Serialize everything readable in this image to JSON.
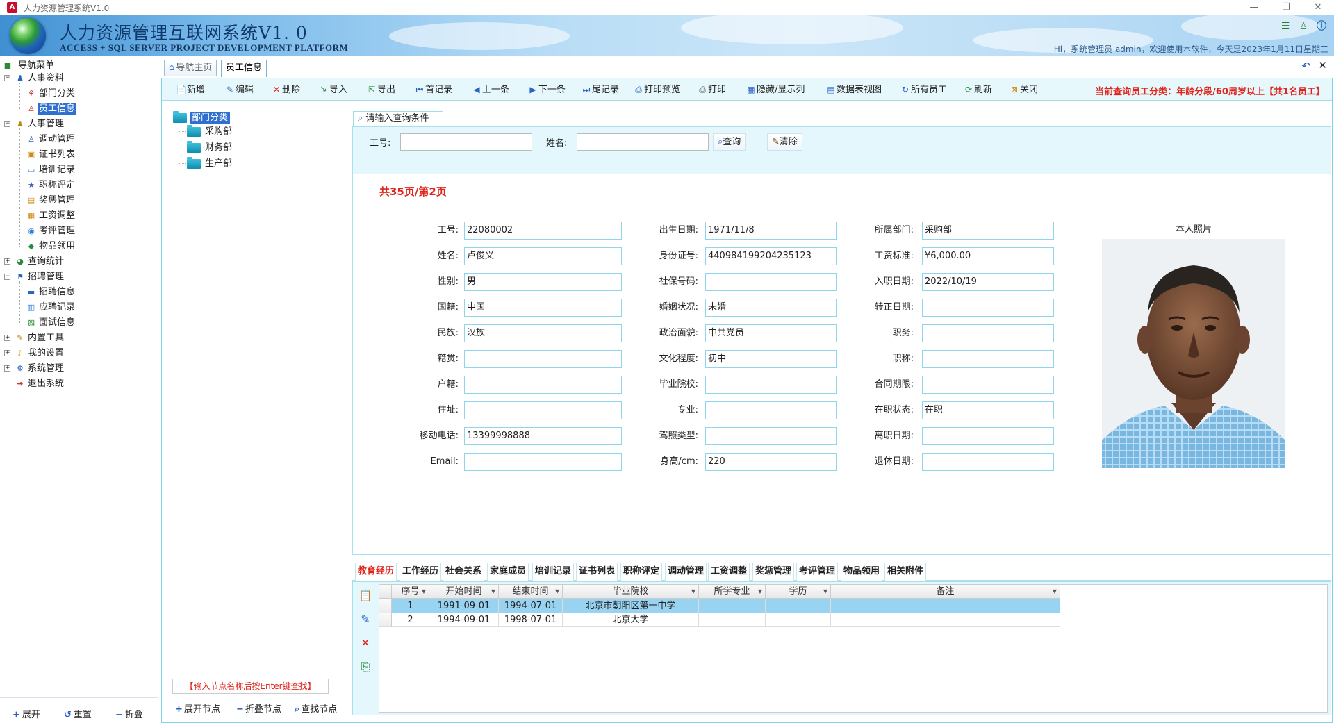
{
  "window": {
    "title": "人力资源管理系统V1.0",
    "app_icon": "A"
  },
  "banner": {
    "title": "人力资源管理互联网系统V1. 0",
    "subtitle": "ACCESS + SQL SERVER PROJECT DEVELOPMENT PLATFORM",
    "welcome": "Hi，系统管理员 admin，欢迎使用本软件，今天是2023年1月11日星期三"
  },
  "nav": {
    "header": "导航菜单",
    "items": [
      {
        "label": "人事资料",
        "level": 1
      },
      {
        "label": "部门分类",
        "level": 2
      },
      {
        "label": "员工信息",
        "level": 2,
        "selected": true
      },
      {
        "label": "人事管理",
        "level": 1
      },
      {
        "label": "调动管理",
        "level": 2
      },
      {
        "label": "证书列表",
        "level": 2
      },
      {
        "label": "培训记录",
        "level": 2
      },
      {
        "label": "职称评定",
        "level": 2
      },
      {
        "label": "奖惩管理",
        "level": 2
      },
      {
        "label": "工资调整",
        "level": 2
      },
      {
        "label": "考评管理",
        "level": 2
      },
      {
        "label": "物品领用",
        "level": 2
      },
      {
        "label": "查询统计",
        "level": 1
      },
      {
        "label": "招聘管理",
        "level": 1
      },
      {
        "label": "招聘信息",
        "level": 2
      },
      {
        "label": "应聘记录",
        "level": 2
      },
      {
        "label": "面试信息",
        "level": 2
      },
      {
        "label": "内置工具",
        "level": 1
      },
      {
        "label": "我的设置",
        "level": 1
      },
      {
        "label": "系统管理",
        "level": 1
      },
      {
        "label": "退出系统",
        "level": 1
      }
    ],
    "bottom": {
      "expand": "展开",
      "reset": "重置",
      "collapse": "折叠"
    }
  },
  "tabs": [
    {
      "label": "导航主页"
    },
    {
      "label": "员工信息",
      "active": true
    }
  ],
  "toolbar": {
    "buttons": [
      "新增",
      "编辑",
      "删除",
      "导入",
      "导出",
      "首记录",
      "上一条",
      "下一条",
      "尾记录",
      "打印预览",
      "打印",
      "隐藏/显示列",
      "数据表视图",
      "所有员工",
      "刷新",
      "关闭"
    ],
    "status": "当前查询员工分类：年龄分段/60周岁以上【共1名员工】"
  },
  "dept_tree": {
    "root": "部门分类",
    "children": [
      "采购部",
      "财务部",
      "生产部"
    ],
    "hint": "【输入节点名称后按Enter键查找】",
    "buttons": {
      "expand": "展开节点",
      "collapse": "折叠节点",
      "find": "查找节点"
    }
  },
  "query": {
    "tab": "请输入查询条件",
    "id_label": "工号:",
    "id_value": "",
    "name_label": "姓名:",
    "name_value": "",
    "search_btn": "查询",
    "clear_btn": "清除"
  },
  "record": {
    "page_info": "共35页/第2页",
    "col1": [
      {
        "label": "工号:",
        "value": "22080002"
      },
      {
        "label": "姓名:",
        "value": "卢俊义"
      },
      {
        "label": "性别:",
        "value": "男"
      },
      {
        "label": "国籍:",
        "value": "中国"
      },
      {
        "label": "民族:",
        "value": "汉族"
      },
      {
        "label": "籍贯:",
        "value": ""
      },
      {
        "label": "户籍:",
        "value": ""
      },
      {
        "label": "住址:",
        "value": ""
      },
      {
        "label": "移动电话:",
        "value": "13399998888"
      },
      {
        "label": "Email:",
        "value": ""
      }
    ],
    "col2": [
      {
        "label": "出生日期:",
        "value": "1971/11/8"
      },
      {
        "label": "身份证号:",
        "value": "440984199204235123"
      },
      {
        "label": "社保号码:",
        "value": ""
      },
      {
        "label": "婚姻状况:",
        "value": "未婚"
      },
      {
        "label": "政治面貌:",
        "value": "中共党员"
      },
      {
        "label": "文化程度:",
        "value": "初中"
      },
      {
        "label": "毕业院校:",
        "value": ""
      },
      {
        "label": "专业:",
        "value": ""
      },
      {
        "label": "驾照类型:",
        "value": ""
      },
      {
        "label": "身高/cm:",
        "value": "220"
      }
    ],
    "col3": [
      {
        "label": "所属部门:",
        "value": "采购部"
      },
      {
        "label": "工资标准:",
        "value": "¥6,000.00"
      },
      {
        "label": "入职日期:",
        "value": "2022/10/19"
      },
      {
        "label": "转正日期:",
        "value": ""
      },
      {
        "label": "职务:",
        "value": ""
      },
      {
        "label": "职称:",
        "value": ""
      },
      {
        "label": "合同期限:",
        "value": ""
      },
      {
        "label": "在职状态:",
        "value": "在职"
      },
      {
        "label": "离职日期:",
        "value": ""
      },
      {
        "label": "退休日期:",
        "value": ""
      }
    ],
    "photo_label": "本人照片"
  },
  "subtabs": [
    "教育经历",
    "工作经历",
    "社会关系",
    "家庭成员",
    "培训记录",
    "证书列表",
    "职称评定",
    "调动管理",
    "工资调整",
    "奖惩管理",
    "考评管理",
    "物品领用",
    "相关附件"
  ],
  "grid": {
    "columns": [
      "序号",
      "开始时间",
      "结束时间",
      "毕业院校",
      "所学专业",
      "学历",
      "备注"
    ],
    "rows": [
      [
        "1",
        "1991-09-01",
        "1994-07-01",
        "北京市朝阳区第一中学",
        "",
        "",
        ""
      ],
      [
        "2",
        "1994-09-01",
        "1998-07-01",
        "北京大学",
        "",
        "",
        ""
      ]
    ]
  },
  "colors": {
    "accent": "#2e6fd0",
    "status_red": "#e0241b",
    "panel_bg": "#e3f7fc",
    "border": "#8fd6ec"
  }
}
